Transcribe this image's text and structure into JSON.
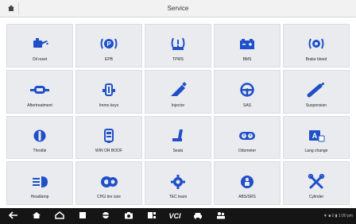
{
  "header": {
    "title": "Service"
  },
  "colors": {
    "icon_blue": "#1f4fc9",
    "tile_bg": "#e9ebee",
    "taskbar_bg": "#151515"
  },
  "tiles": [
    {
      "label": "Oil reset",
      "icon": "oil-can-icon"
    },
    {
      "label": "EPB",
      "icon": "parking-brake-icon"
    },
    {
      "label": "TPMS",
      "icon": "tire-pressure-icon"
    },
    {
      "label": "BMS",
      "icon": "battery-icon"
    },
    {
      "label": "Brake bleed",
      "icon": "brake-icon"
    },
    {
      "label": "Aftertreatment",
      "icon": "exhaust-filter-icon"
    },
    {
      "label": "Immo keys",
      "icon": "immo-key-icon"
    },
    {
      "label": "Injector",
      "icon": "injector-icon"
    },
    {
      "label": "SAS",
      "icon": "steering-wheel-icon"
    },
    {
      "label": "Suspension",
      "icon": "suspension-icon"
    },
    {
      "label": "Throttle",
      "icon": "throttle-icon"
    },
    {
      "label": "WIN OR BOOF",
      "icon": "gearbox-icon"
    },
    {
      "label": "Seats",
      "icon": "seat-icon"
    },
    {
      "label": "Odometer",
      "icon": "odometer-icon"
    },
    {
      "label": "Lang change",
      "icon": "language-icon"
    },
    {
      "label": "Headlamp",
      "icon": "headlamp-icon"
    },
    {
      "label": "CHG tire size",
      "icon": "tire-size-icon"
    },
    {
      "label": "TEC learn",
      "icon": "gear-learn-icon"
    },
    {
      "label": "ABS/SRS",
      "icon": "airbag-icon"
    },
    {
      "label": "Cylinder",
      "icon": "cylinder-tools-icon"
    }
  ],
  "taskbar": {
    "vci_label": "VCI",
    "status_text": "▼ ■ 0 ▮ 1:00 pm"
  }
}
